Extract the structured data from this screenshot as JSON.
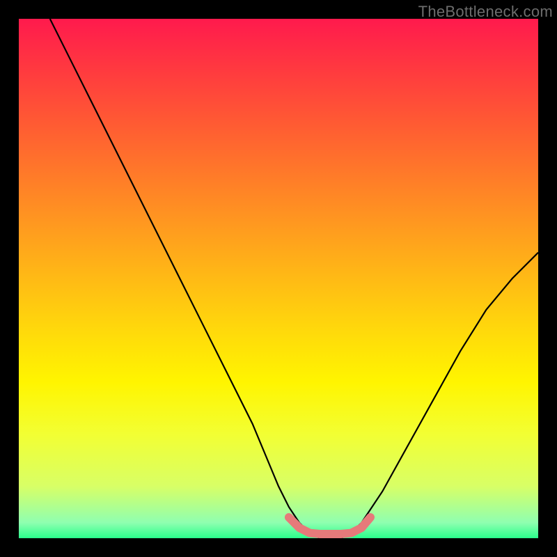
{
  "watermark": "TheBottleneck.com",
  "chart_data": {
    "type": "line",
    "title": "",
    "xlabel": "",
    "ylabel": "",
    "xlim": [
      0,
      100
    ],
    "ylim": [
      0,
      100
    ],
    "grid": false,
    "legend": false,
    "series": [
      {
        "name": "bottleneck-curve",
        "x": [
          6,
          10,
          15,
          20,
          25,
          30,
          35,
          40,
          45,
          50,
          52,
          54,
          56,
          58,
          60,
          62,
          64,
          66,
          70,
          75,
          80,
          85,
          90,
          95,
          100
        ],
        "values": [
          100,
          92,
          82,
          72,
          62,
          52,
          42,
          32,
          22,
          10,
          6,
          3,
          1,
          0,
          0,
          0,
          1,
          3,
          9,
          18,
          27,
          36,
          44,
          50,
          55
        ]
      }
    ],
    "highlight": {
      "name": "optimal-range",
      "x": [
        52,
        54,
        56,
        58,
        60,
        62,
        64,
        66
      ],
      "values": [
        3,
        1,
        0,
        0,
        0,
        0,
        1,
        3
      ]
    },
    "background_gradient": {
      "top": "#ff1a4d",
      "mid_high": "#ff9a1f",
      "mid": "#fff500",
      "low": "#2aff8c"
    }
  }
}
